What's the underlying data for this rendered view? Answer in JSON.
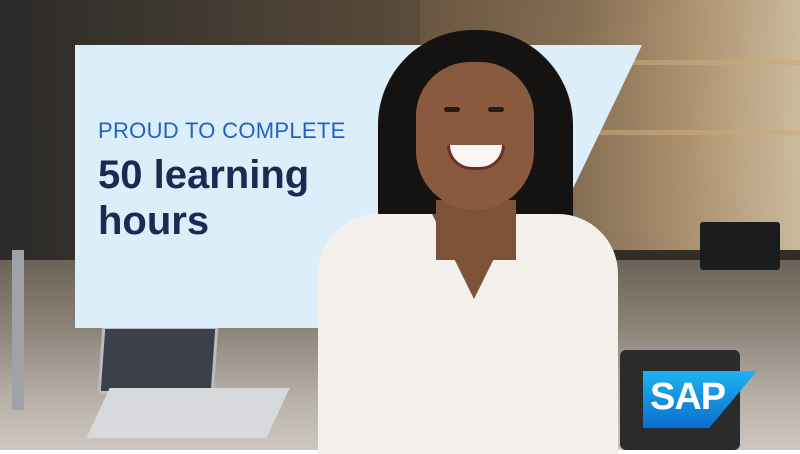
{
  "banner": {
    "kicker": "PROUD TO COMPLETE",
    "headline": "50 learning hours",
    "colors": {
      "panel": "#ddeefb",
      "kicker": "#1d62c6",
      "headline": "#1b2a52"
    }
  },
  "brand": {
    "logo_text": "SAP",
    "logo_colors": [
      "#1fb3f0",
      "#0a6ecf"
    ]
  },
  "photo": {
    "subject": "smiling-woman-photo"
  }
}
